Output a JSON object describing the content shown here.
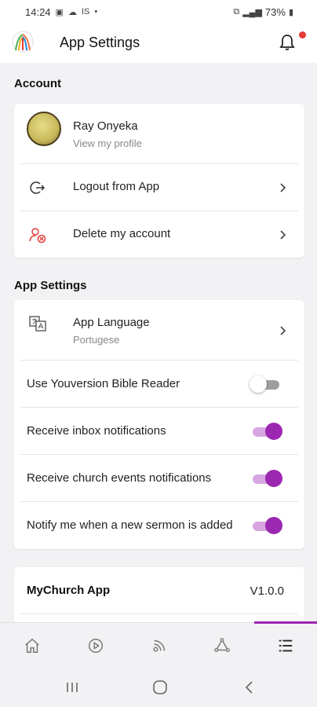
{
  "status_bar": {
    "time": "14:24",
    "carrier_text": "IS",
    "battery": "73%"
  },
  "header": {
    "title": "App Settings"
  },
  "account": {
    "section_title": "Account",
    "profile_name": "Ray Onyeka",
    "profile_sub": "View my profile",
    "logout_label": "Logout from App",
    "delete_label": "Delete my account"
  },
  "app_settings": {
    "section_title": "App Settings",
    "language_label": "App Language",
    "language_value": "Portugese",
    "toggles": [
      {
        "label": "Use Youversion Bible Reader",
        "on": false
      },
      {
        "label": "Receive inbox notifications",
        "on": true
      },
      {
        "label": "Receive church events notifications",
        "on": true
      },
      {
        "label": "Notify me when a new sermon is added",
        "on": true
      }
    ]
  },
  "about": {
    "app_name": "MyChurch App",
    "version": "V1.0.0"
  },
  "tabs": [
    "home-icon",
    "play-icon",
    "podcast-icon",
    "community-icon",
    "menu-list-icon"
  ],
  "active_tab": 4,
  "colors": {
    "accent": "#9c27b0",
    "notification_dot": "#e53935",
    "danger_icon": "#e53935"
  }
}
